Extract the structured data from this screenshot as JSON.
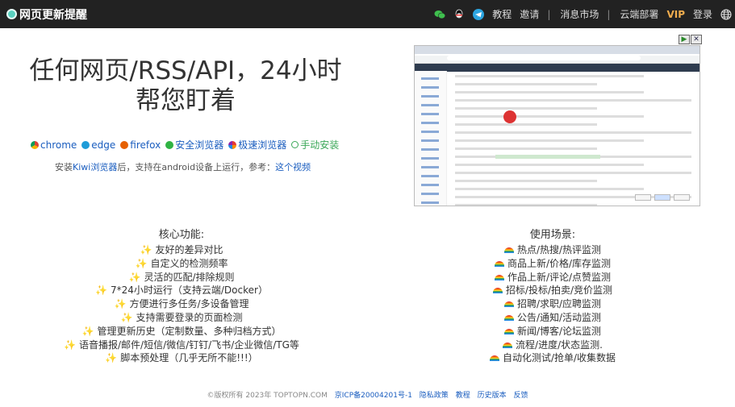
{
  "navbar": {
    "brand": "网页更新提醒",
    "icons": [
      "wechat-icon",
      "qq-icon",
      "telegram-icon"
    ],
    "links": [
      "教程",
      "邀请"
    ],
    "separator": "|",
    "market": "消息市场",
    "cloud": "云端部署",
    "vip": "VIP",
    "login": "登录",
    "language_icon": "globe-icon"
  },
  "hero": {
    "title_line1": "任何网页/RSS/API，24小时",
    "title_line2": "帮您盯着",
    "browsers": [
      {
        "label": "chrome",
        "color": "#4a8af4"
      },
      {
        "label": "edge",
        "color": "#1f9cd8"
      },
      {
        "label": "firefox",
        "color": "#e66000"
      },
      {
        "label": "安全浏览器",
        "color": "#2fb344"
      },
      {
        "label": "极速浏览器",
        "color": "#c94be0"
      },
      {
        "label": "手动安装",
        "color": "#3aa757"
      }
    ],
    "note_prefix": "安装",
    "note_kiwi": "Kiwi浏览器",
    "note_middle": "后，支持在android设备上运行，参考：",
    "note_video": "这个视频"
  },
  "features": {
    "title": "核心功能:",
    "items": [
      "友好的差异对比",
      "自定义的检测频率",
      "灵活的匹配/排除规则",
      "7*24小时运行（支持云端/Docker）",
      "方便进行多任务/多设备管理",
      "支持需要登录的页面检测",
      "管理更新历史（定制数量、多种归档方式）",
      "语音播报/邮件/短信/微信/钉钉/飞书/企业微信/TG等",
      "脚本预处理（几乎无所不能!!!）"
    ]
  },
  "scenarios": {
    "title": "使用场景:",
    "items": [
      "热点/热搜/热评监测",
      "商品上新/价格/库存监测",
      "作品上新/评论/点赞监测",
      "招标/投标/拍卖/竞价监测",
      "招聘/求职/应聘监测",
      "公告/通知/活动监测",
      "新闻/博客/论坛监测",
      "流程/进度/状态监测.",
      "自动化测试/抢单/收集数据"
    ]
  },
  "footer": {
    "copyright": "©版权所有 2023年 TOPTOPN.COM",
    "icp": "京ICP备20004201号-1",
    "privacy": "隐私政策",
    "tutorial": "教程",
    "history": "历史版本",
    "feedback": "反馈"
  }
}
